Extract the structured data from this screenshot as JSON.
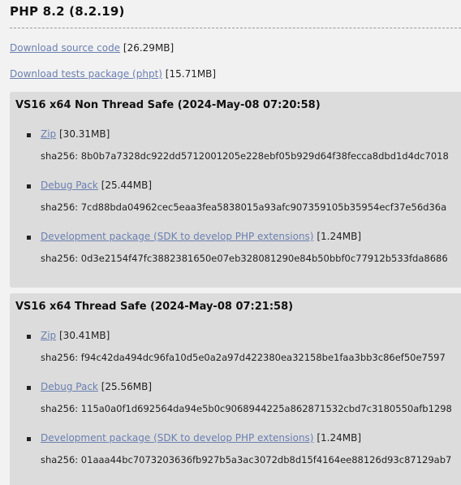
{
  "release": {
    "title": "PHP 8.2 (8.2.19)",
    "source": {
      "label": "Download source code",
      "size": "[26.29MB]"
    },
    "tests": {
      "label": "Download tests package (phpt)",
      "size": "[15.71MB]"
    }
  },
  "builds": [
    {
      "title": "VS16 x64 Non Thread Safe (2024-May-08 07:20:58)",
      "items": [
        {
          "label": "Zip",
          "size": "[30.31MB]",
          "sha": "sha256: 8b0b7a7328dc922dd5712001205e228ebf05b929d64f38fecca8dbd1d4dc7018"
        },
        {
          "label": "Debug Pack",
          "size": "[25.44MB]",
          "sha": "sha256: 7cd88bda04962cec5eaa3fea5838015a93afc907359105b35954ecf37e56d36a"
        },
        {
          "label": "Development package (SDK to develop PHP extensions)",
          "size": "[1.24MB]",
          "sha": "sha256: 0d3e2154f47fc3882381650e07eb328081290e84b50bbf0c77912b533fda8686"
        }
      ]
    },
    {
      "title": "VS16 x64 Thread Safe (2024-May-08 07:21:58)",
      "items": [
        {
          "label": "Zip",
          "size": "[30.41MB]",
          "sha": "sha256: f94c42da494dc96fa10d5e0a2a97d422380ea32158be1faa3bb3c86ef50e7597"
        },
        {
          "label": "Debug Pack",
          "size": "[25.56MB]",
          "sha": "sha256: 115a0a0f1d692564da94e5b0c9068944225a862871532cbd7c3180550afb1298"
        },
        {
          "label": "Development package (SDK to develop PHP extensions)",
          "size": "[1.24MB]",
          "sha": "sha256: 01aaa44bc7073203636fb927b5a3ac3072db8d15f4164ee88126d93c87129ab7"
        }
      ]
    }
  ]
}
